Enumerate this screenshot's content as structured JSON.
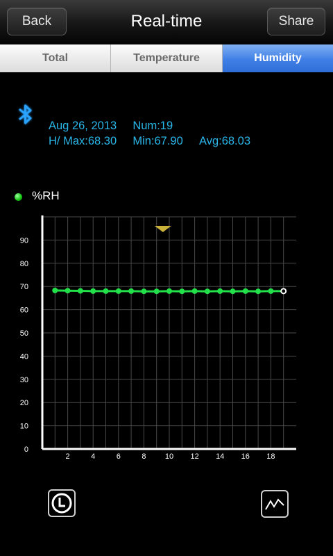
{
  "nav": {
    "back_label": "Back",
    "title": "Real-time",
    "share_label": "Share"
  },
  "tabs": [
    {
      "label": "Total",
      "active": false
    },
    {
      "label": "Temperature",
      "active": false
    },
    {
      "label": "Humidity",
      "active": true
    }
  ],
  "status": {
    "icon": "bluetooth-icon",
    "icon_color": "#2aa3ff"
  },
  "info": {
    "date": "Aug 26, 2013",
    "num": "Num:19",
    "max": "H/ Max:68.30",
    "min": "Min:67.90",
    "avg": "Avg:68.03",
    "color": "#29b7e8"
  },
  "legend": {
    "label": "%RH",
    "color": "#19c419"
  },
  "chart_data": {
    "type": "line",
    "series": [
      {
        "name": "%RH",
        "color": "#22e04a",
        "x": [
          1,
          2,
          3,
          4,
          5,
          6,
          7,
          8,
          9,
          10,
          11,
          12,
          13,
          14,
          15,
          16,
          17,
          18,
          19
        ],
        "values": [
          68.3,
          68.2,
          68.1,
          68.0,
          68.0,
          68.0,
          68.0,
          67.9,
          67.9,
          68.0,
          67.9,
          68.0,
          67.9,
          68.0,
          67.9,
          68.0,
          67.9,
          68.0,
          68.0
        ]
      }
    ],
    "xlim": [
      0,
      20
    ],
    "ylim": [
      0,
      100
    ],
    "x_ticks": [
      2,
      4,
      6,
      8,
      10,
      12,
      14,
      16,
      18
    ],
    "y_ticks": [
      0,
      10,
      20,
      30,
      40,
      50,
      60,
      70,
      80,
      90
    ],
    "grid": true,
    "marker_x": 9.5,
    "marker_color": "#c9b13a",
    "last_point_marker": "hollow-white"
  },
  "footer": {
    "left_icon": "clock-icon",
    "right_icon": "line-chart-icon"
  }
}
